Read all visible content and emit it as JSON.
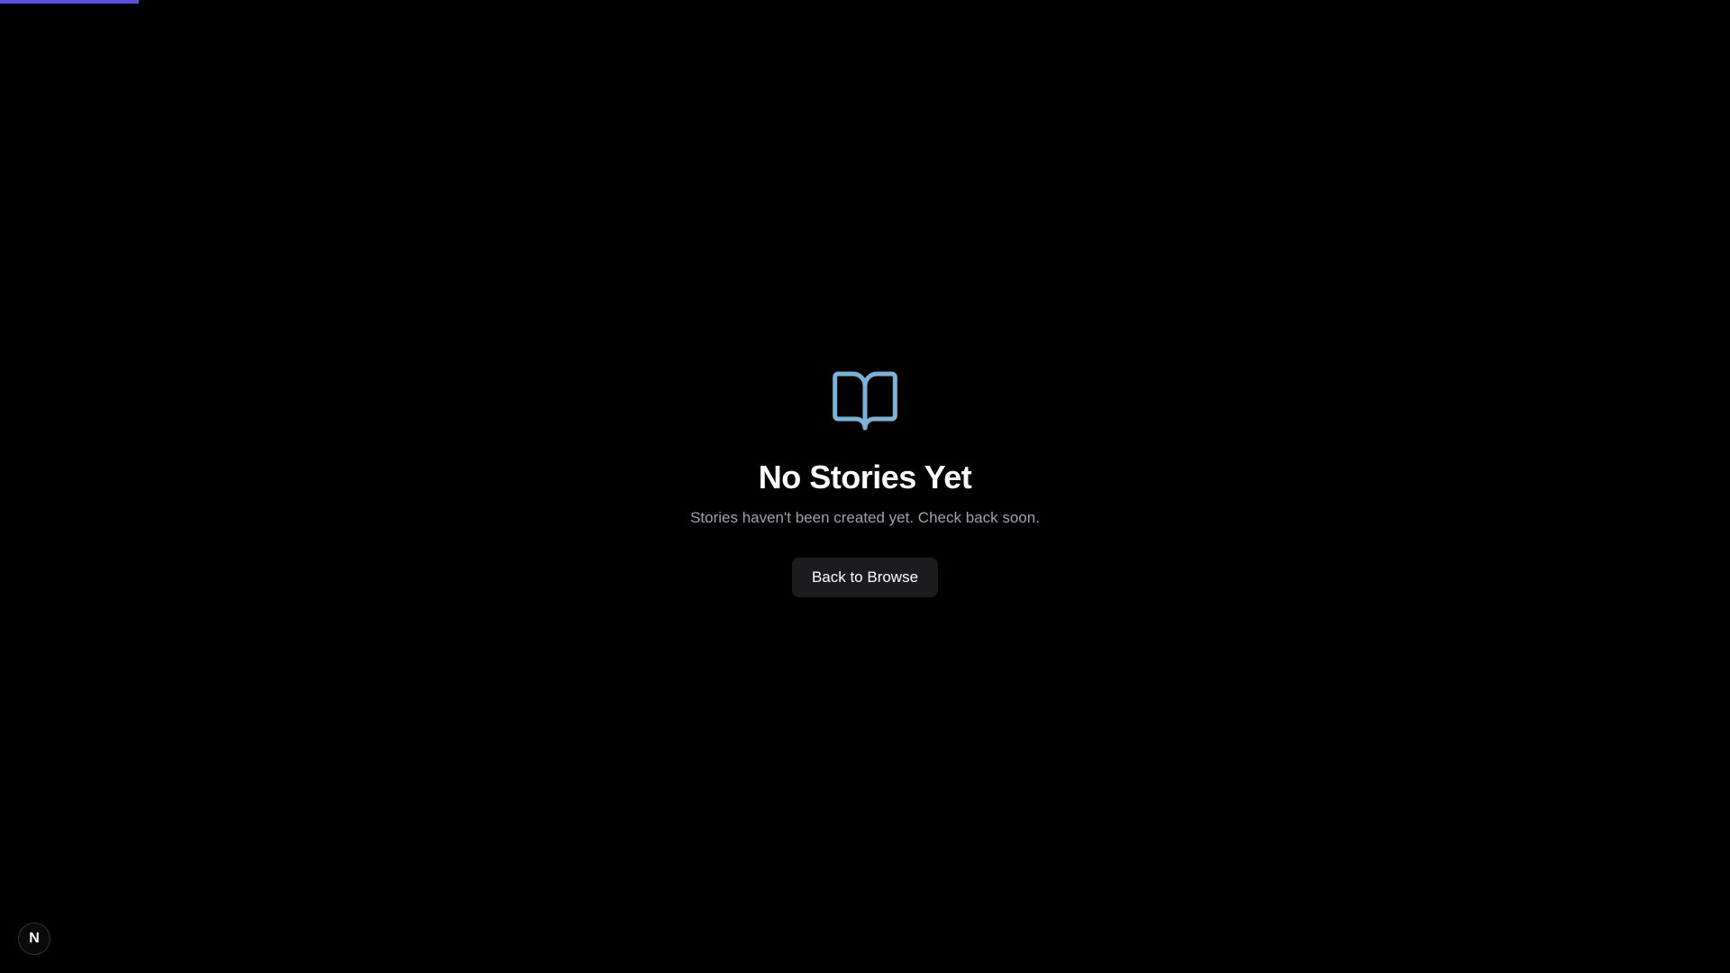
{
  "progress": {
    "fraction": 0.08,
    "color": "#5b4fe0"
  },
  "empty_state": {
    "icon": "book-open-icon",
    "icon_color": "#7ab3d6",
    "title": "No Stories Yet",
    "subtitle": "Stories haven't been created yet. Check back soon.",
    "button_label": "Back to Browse"
  },
  "dev_badge": {
    "icon": "nextjs-logo-icon",
    "letter": "N"
  }
}
